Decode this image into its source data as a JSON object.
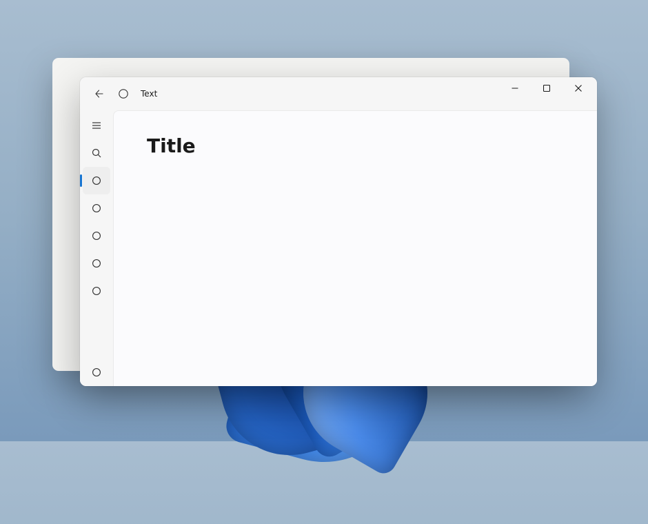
{
  "titlebar": {
    "title": "Text"
  },
  "content": {
    "page_title": "Title"
  }
}
